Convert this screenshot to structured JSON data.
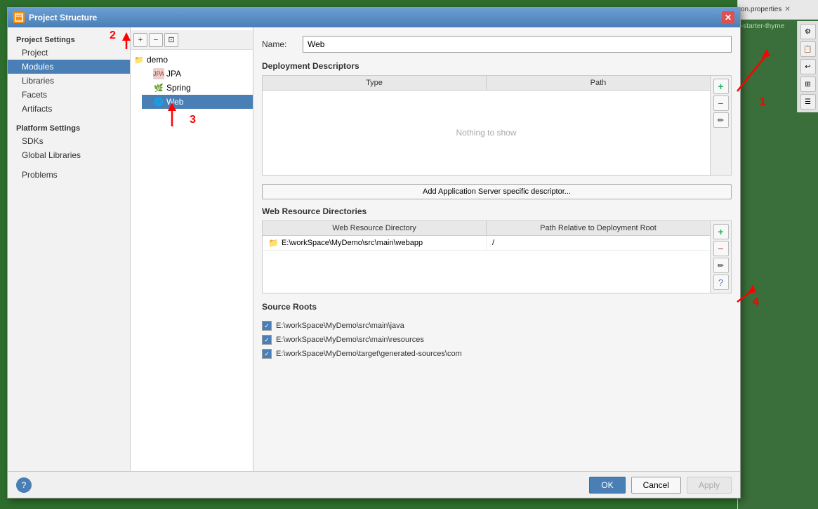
{
  "dialog": {
    "title": "Project Structure",
    "icon": "🔧"
  },
  "sidebar": {
    "project_settings_label": "Project Settings",
    "items": [
      {
        "id": "project",
        "label": "Project"
      },
      {
        "id": "modules",
        "label": "Modules",
        "active": true
      },
      {
        "id": "libraries",
        "label": "Libraries"
      },
      {
        "id": "facets",
        "label": "Facets"
      },
      {
        "id": "artifacts",
        "label": "Artifacts"
      }
    ],
    "platform_settings_label": "Platform Settings",
    "platform_items": [
      {
        "id": "sdks",
        "label": "SDKs"
      },
      {
        "id": "global_libraries",
        "label": "Global Libraries"
      }
    ],
    "problems_label": "Problems"
  },
  "tree": {
    "toolbar": {
      "add": "+",
      "remove": "−",
      "copy": "⊡"
    },
    "nodes": [
      {
        "id": "demo",
        "label": "demo",
        "type": "folder",
        "level": 0
      },
      {
        "id": "jpa",
        "label": "JPA",
        "type": "jpa",
        "level": 1
      },
      {
        "id": "spring",
        "label": "Spring",
        "type": "spring",
        "level": 1
      },
      {
        "id": "web",
        "label": "Web",
        "type": "web",
        "level": 1,
        "active": true
      }
    ]
  },
  "main": {
    "name_label": "Name:",
    "name_value": "Web",
    "deployment_descriptors_label": "Deployment Descriptors",
    "table_type_header": "Type",
    "table_path_header": "Path",
    "nothing_to_show": "Nothing to show",
    "add_button_label": "Add Application Server specific descriptor...",
    "web_resource_label": "Web Resource Directories",
    "web_resource_dir_header": "Web Resource Directory",
    "path_relative_header": "Path Relative to Deployment Root",
    "resource_row": {
      "directory": "E:\\workSpace\\MyDemo\\src\\main\\webapp",
      "path": "/"
    },
    "source_roots_label": "Source Roots",
    "source_roots": [
      {
        "path": "E:\\workSpace\\MyDemo\\src\\main\\java",
        "checked": true
      },
      {
        "path": "E:\\workSpace\\MyDemo\\src\\main\\resources",
        "checked": true
      },
      {
        "path": "E:\\workSpace\\MyDemo\\target\\generated-sources\\com",
        "checked": true
      }
    ]
  },
  "footer": {
    "ok_label": "OK",
    "cancel_label": "Cancel",
    "apply_label": "Apply"
  },
  "annotations": {
    "one": "1",
    "two": "2",
    "three": "3",
    "four": "4"
  },
  "right_panel": {
    "tab_label": "on.properties",
    "starter_text": "-starter-thyme"
  }
}
